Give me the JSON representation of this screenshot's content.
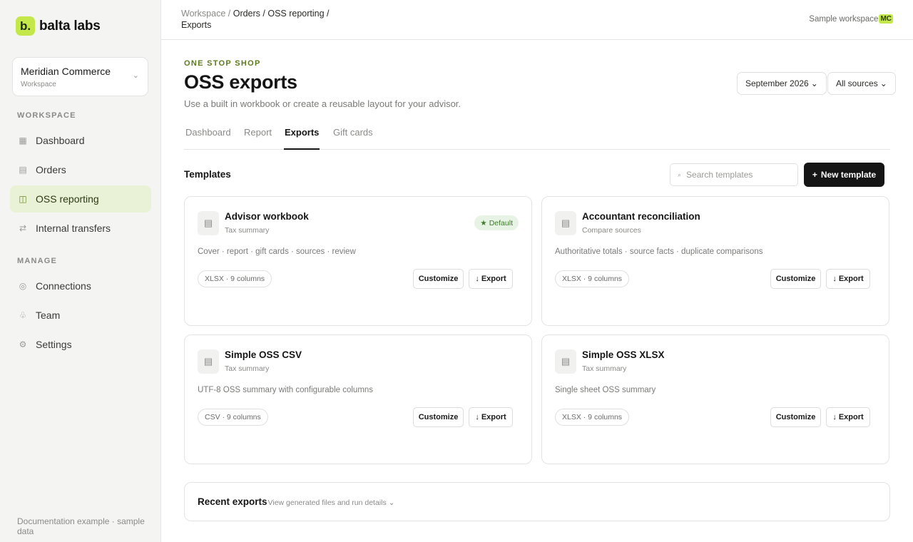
{
  "brand": {
    "mark": "b.",
    "name": "balta labs"
  },
  "workspace_switcher": {
    "name": "Meridian Commerce",
    "subtitle": "Workspace",
    "chevron": "⌄"
  },
  "sidebar": {
    "section_workspace": "WORKSPACE",
    "section_manage": "MANAGE",
    "items": [
      {
        "label": "Dashboard",
        "icon": "grid-icon",
        "glyph": "▦",
        "active": false
      },
      {
        "label": "Orders",
        "icon": "list-icon",
        "glyph": "▤",
        "active": false
      },
      {
        "label": "OSS reporting",
        "icon": "columns-icon",
        "glyph": "◫",
        "active": true
      },
      {
        "label": "Internal transfers",
        "icon": "transfer-icon",
        "glyph": "⇄",
        "active": false
      },
      {
        "label": "Connections",
        "icon": "connection-icon",
        "glyph": "◎",
        "active": false
      },
      {
        "label": "Team",
        "icon": "team-icon",
        "glyph": "♧",
        "active": false
      },
      {
        "label": "Settings",
        "icon": "gear-icon",
        "glyph": "⚙",
        "active": false
      }
    ],
    "footer": "Documentation example · sample data"
  },
  "breadcrumb": {
    "workspace": "Workspace",
    "sep": " / ",
    "orders": "Orders",
    "oss": "OSS reporting",
    "current": "Exports"
  },
  "topbar": {
    "workspace_label": "Sample workspace",
    "avatar_initials": "MC"
  },
  "header": {
    "eyebrow": "ONE STOP SHOP",
    "title": "OSS exports",
    "subtitle": "Use a built in workbook or create a reusable layout for your advisor.",
    "period_filter": "September 2026",
    "source_filter": "All sources",
    "chevron": "⌄"
  },
  "tabs": [
    "Dashboard",
    "Report",
    "Exports",
    "Gift cards"
  ],
  "active_tab": "Exports",
  "templates": {
    "heading": "Templates",
    "search_placeholder": "Search templates",
    "search_glyph": "⌕",
    "new_button": "New template",
    "new_glyph": "+",
    "customize_label": "Customize",
    "export_label": "Export",
    "export_glyph": "↓",
    "icon_glyph": "▤",
    "cards": [
      {
        "title": "Advisor workbook",
        "subtitle": "Tax summary",
        "badge": "Default",
        "badge_glyph": "★",
        "description": "Cover · report · gift cards · sources · review",
        "format": "XLSX · 9 columns"
      },
      {
        "title": "Accountant reconciliation",
        "subtitle": "Compare sources",
        "badge": "",
        "badge_glyph": "",
        "description": "Authoritative totals · source facts · duplicate comparisons",
        "format": "XLSX · 9 columns"
      },
      {
        "title": "Simple OSS CSV",
        "subtitle": "Tax summary",
        "badge": "",
        "badge_glyph": "",
        "description": "UTF-8 OSS summary with configurable columns",
        "format": "CSV · 9 columns"
      },
      {
        "title": "Simple OSS XLSX",
        "subtitle": "Tax summary",
        "badge": "",
        "badge_glyph": "",
        "description": "Single sheet OSS summary",
        "format": "XLSX · 9 columns"
      }
    ]
  },
  "recent_exports": {
    "title": "Recent exports",
    "subtitle": "View generated files and run details ⌄"
  }
}
